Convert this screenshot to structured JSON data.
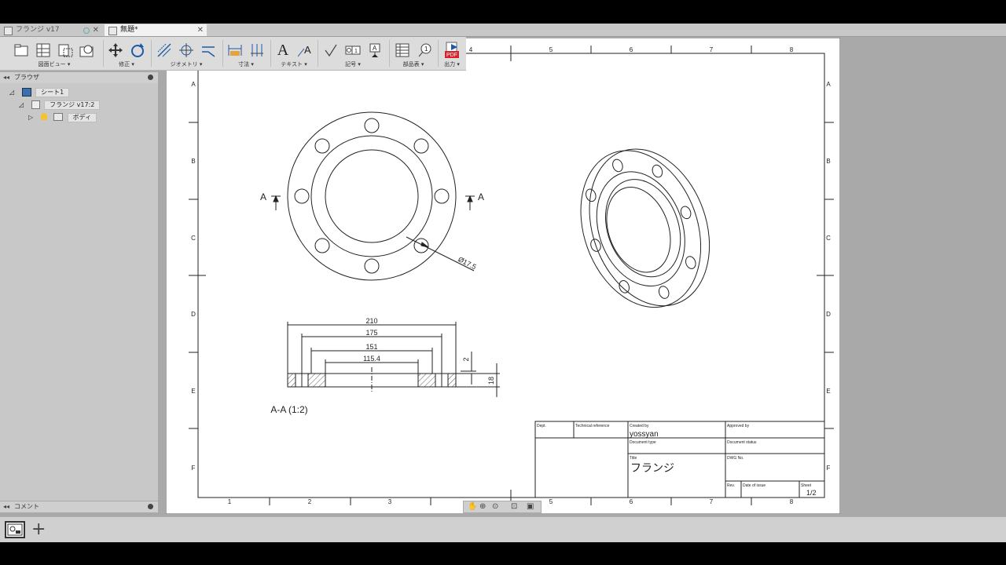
{
  "tabs": [
    {
      "label": "フランジ v17",
      "active": false
    },
    {
      "label": "無題*",
      "active": true
    }
  ],
  "toolbar": {
    "groups": [
      {
        "label": "図面ビュー ▾"
      },
      {
        "label": "修正 ▾"
      },
      {
        "label": "ジオメトリ ▾"
      },
      {
        "label": "寸法 ▾"
      },
      {
        "label": "テキスト ▾"
      },
      {
        "label": "記号 ▾"
      },
      {
        "label": "部品表 ▾"
      },
      {
        "label": "出力 ▾"
      }
    ],
    "pdf_badge": "PDF"
  },
  "browser": {
    "title": "ブラウザ",
    "collapse": "◂◂",
    "tree": [
      {
        "label": "シート1"
      },
      {
        "label": "フランジ v17:2"
      },
      {
        "label": "ボディ"
      }
    ]
  },
  "comments": {
    "title": "コメント",
    "collapse": "◂◂"
  },
  "drawing": {
    "border_cols": [
      "1",
      "2",
      "3",
      "4",
      "5",
      "6",
      "7",
      "8"
    ],
    "border_rows": [
      "A",
      "B",
      "C",
      "D",
      "E",
      "F"
    ],
    "section_mark": "A",
    "hole_callout": "Ø17.5",
    "dims": {
      "d210": "210",
      "d175": "175",
      "d151": "151",
      "d115": "115.4",
      "d2": "2",
      "d18": "18"
    },
    "section_label": "A-A (1:2)"
  },
  "titleblock": {
    "dept_label": "Dept.",
    "techref_label": "Technical reference",
    "created_label": "Created by",
    "created_value": "yossyan",
    "approved_label": "Approved by",
    "doctype_label": "Document type",
    "docstatus_label": "Document status",
    "title_label": "Title",
    "title_value": "フランジ",
    "dwgno_label": "DWG No.",
    "rev_label": "Rev.",
    "date_label": "Date of issue",
    "sheet_label": "Sheet",
    "sheet_value": "1/2"
  },
  "colors": {
    "workspace": "#a9a9a9",
    "sheet": "#ffffff",
    "line": "#222222",
    "pdf_red": "#d2232a",
    "tool_blue": "#1e5aa8",
    "tool_orange": "#e6a23c"
  }
}
